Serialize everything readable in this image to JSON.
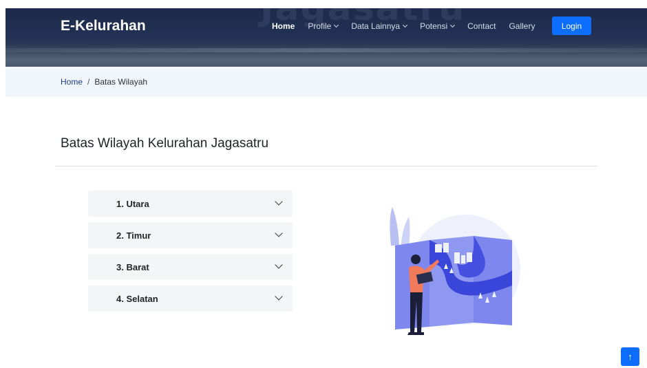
{
  "header": {
    "background_text": "Jagasatru",
    "brand": "E-Kelurahan",
    "nav": [
      {
        "label": "Home",
        "active": true,
        "dropdown": false
      },
      {
        "label": "Profile",
        "active": false,
        "dropdown": true
      },
      {
        "label": "Data Lainnya",
        "active": false,
        "dropdown": true
      },
      {
        "label": "Potensi",
        "active": false,
        "dropdown": true
      },
      {
        "label": "Contact",
        "active": false,
        "dropdown": false
      },
      {
        "label": "Gallery",
        "active": false,
        "dropdown": false
      }
    ],
    "login_label": "Login"
  },
  "breadcrumb": {
    "home": "Home",
    "separator": "/",
    "current": "Batas Wilayah"
  },
  "main": {
    "title": "Batas Wilayah Kelurahan Jagasatru",
    "accordion": [
      {
        "label": "1. Utara"
      },
      {
        "label": "2. Timur"
      },
      {
        "label": "3. Barat"
      },
      {
        "label": "4. Selatan"
      }
    ],
    "illustration_icon": "map-illustration"
  },
  "back_to_top_icon": "arrow-up-icon",
  "colors": {
    "primary": "#0d6efd",
    "header_bg": "#1d2a4b",
    "breadcrumb_bg": "#f1f5fc",
    "accordion_bg": "#f4f5f7",
    "illustration_blue": "#5661e8"
  }
}
